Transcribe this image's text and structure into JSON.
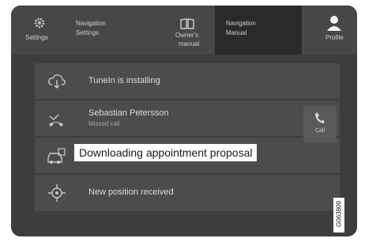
{
  "topbar": {
    "settings": {
      "label": "Settings",
      "icon": "gear-icon"
    },
    "navigation_settings": {
      "label_line1": "Navigation",
      "label_line2": "Settings"
    },
    "owners_manual": {
      "label_line1": "Owner's",
      "label_line2": "manual",
      "icon": "book-icon"
    },
    "navigation_manual": {
      "label_line1": "Navigation",
      "label_line2": "Manual"
    },
    "profile": {
      "label": "Profile",
      "icon": "person-icon"
    }
  },
  "notifications": [
    {
      "title": "TuneIn is installing",
      "icon": "cloud-download-icon"
    },
    {
      "title": "Sebastian Petersson",
      "subtitle": "Missed call",
      "icon": "missed-call-icon",
      "action_label": "Call",
      "action_icon": "phone-icon"
    },
    {
      "title": "Downloading appointment proposal",
      "icon": "car-service-icon"
    },
    {
      "title": "New position received",
      "icon": "position-target-icon"
    }
  ],
  "image_code": "G063809",
  "colors": {
    "screen_bg": "#3d3d3d",
    "topbar_bg": "#474747",
    "active_tab_bg": "#2a2a2a",
    "row_bg": "#4c4c4c",
    "highlight_bg": "#ffffff"
  }
}
